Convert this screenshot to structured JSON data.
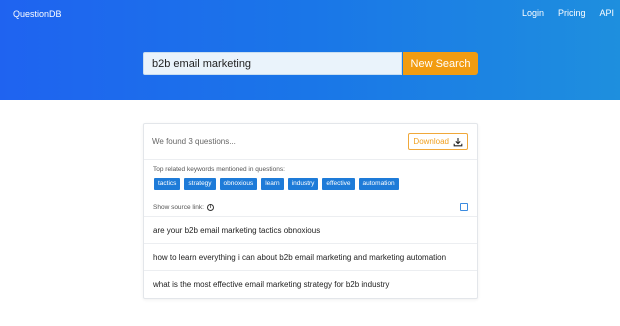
{
  "header": {
    "brand": "QuestionDB",
    "nav": [
      "Login",
      "Pricing",
      "API"
    ]
  },
  "search": {
    "value": "b2b email marketing",
    "button_label": "New Search"
  },
  "results": {
    "summary": "We found 3 questions...",
    "download_label": "Download",
    "keywords_title": "Top related keywords mentioned in questions:",
    "keywords": [
      "tactics",
      "strategy",
      "obnoxious",
      "learn",
      "industry",
      "effective",
      "automation"
    ],
    "source_link_label": "Show source link:",
    "questions": [
      "are your b2b email marketing tactics obnoxious",
      "how to learn everything i can about b2b email marketing and marketing automation",
      "what is the most effective email marketing strategy for b2b industry"
    ]
  },
  "colors": {
    "accent": "#1e7bd8",
    "button": "#f29c11",
    "header_gradient_start": "#1f63f0",
    "header_gradient_end": "#1e8fde"
  }
}
